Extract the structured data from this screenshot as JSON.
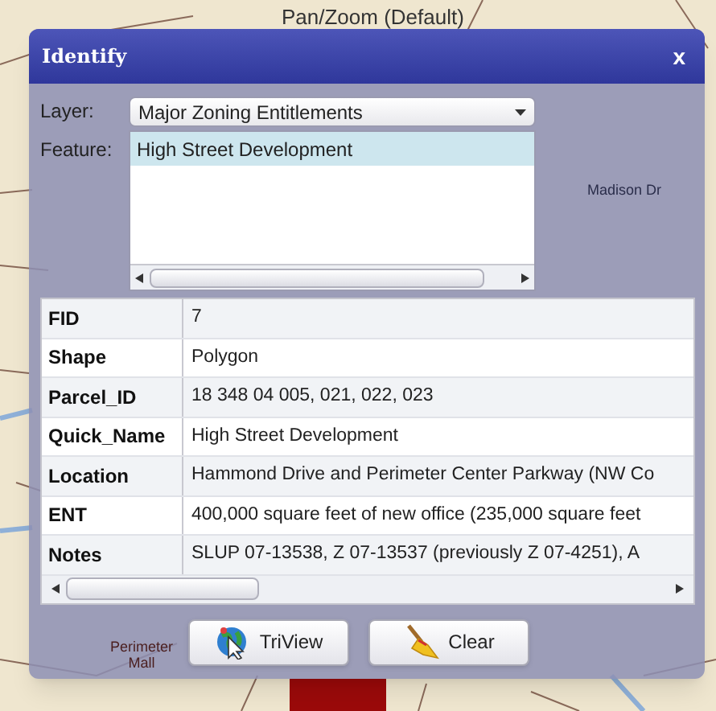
{
  "map": {
    "labels": [
      {
        "text": "Pan/Zoom (Default)",
        "kind": "tool"
      },
      {
        "text": "Madison Dr",
        "kind": "street"
      },
      {
        "text": "Perimeter Mall",
        "kind": "place"
      }
    ]
  },
  "dialog": {
    "title": "Identify",
    "close": "x",
    "layer": {
      "label": "Layer:",
      "value": "Major Zoning Entitlements"
    },
    "feature": {
      "label": "Feature:",
      "items": [
        {
          "text": "High Street Development",
          "selected": true
        }
      ]
    },
    "attributes": [
      {
        "field": "FID",
        "value": "7"
      },
      {
        "field": "Shape",
        "value": "Polygon"
      },
      {
        "field": "Parcel_ID",
        "value": "18 348 04 005, 021, 022, 023"
      },
      {
        "field": "Quick_Name",
        "value": "High Street Development"
      },
      {
        "field": "Location",
        "value": "Hammond Drive and Perimeter Center Parkway (NW Co"
      },
      {
        "field": "ENT",
        "value": "400,000 square feet of new office (235,000 square feet"
      },
      {
        "field": "Notes",
        "value": "SLUP 07-13538, Z 07-13537 (previously Z 07-4251), A"
      }
    ],
    "buttons": [
      {
        "label": "TriView",
        "kind": "globe"
      },
      {
        "label": "Clear",
        "kind": "broom"
      }
    ]
  }
}
